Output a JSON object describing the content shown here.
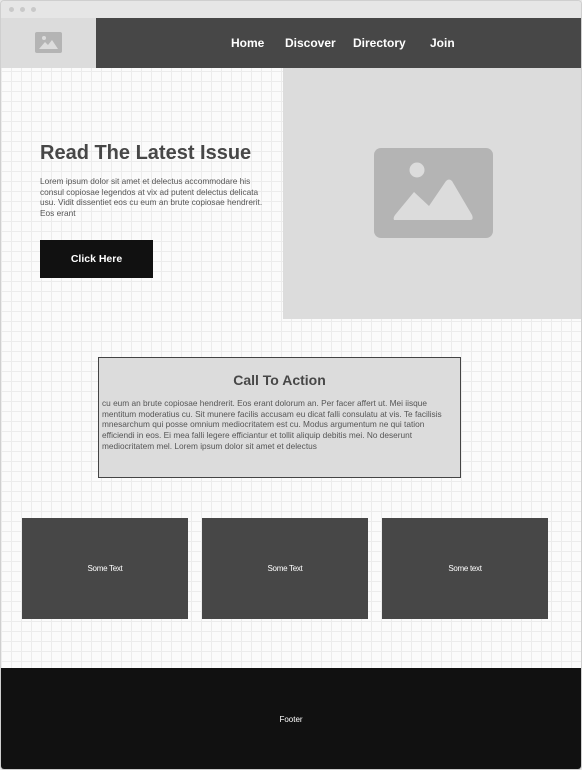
{
  "nav": {
    "items": [
      {
        "label": "Home"
      },
      {
        "label": "Discover"
      },
      {
        "label": "Directory"
      },
      {
        "label": "Join"
      }
    ]
  },
  "hero": {
    "title": "Read The Latest Issue",
    "body": "Lorem ipsum dolor sit amet et delectus accommodare his consul copiosae legendos at vix ad putent delectus delicata usu. Vidit dissentiet eos cu eum an brute copiosae hendrerit. Eos erant",
    "button_label": "Click Here",
    "image_icon": "image-placeholder-icon"
  },
  "call_to_action": {
    "title": "Call To Action",
    "body": "cu eum an brute copiosae hendrerit. Eos erant dolorum an. Per facer affert ut. Mei iisque mentitum moderatius cu. Sit munere facilis accusam eu dicat falli consulatu at vis. Te facilisis mnesarchum qui posse omnium mediocritatem est cu. Modus argumentum ne qui tation efficiendi in eos. Ei mea falli legere efficiantur et tollit aliquip debitis mei. No deserunt mediocritatem mel. Lorem ipsum dolor sit amet et delectus"
  },
  "cards": [
    {
      "label": "Some Text"
    },
    {
      "label": "Some Text"
    },
    {
      "label": "Some text"
    }
  ],
  "footer": {
    "label": "Footer"
  },
  "logo_icon": "image-placeholder-icon",
  "colors": {
    "header_bg": "#474747",
    "image_placeholder_bg": "#dcdcdc",
    "button_bg": "#111111",
    "footer_bg": "#111111",
    "card_bg": "#474747"
  }
}
